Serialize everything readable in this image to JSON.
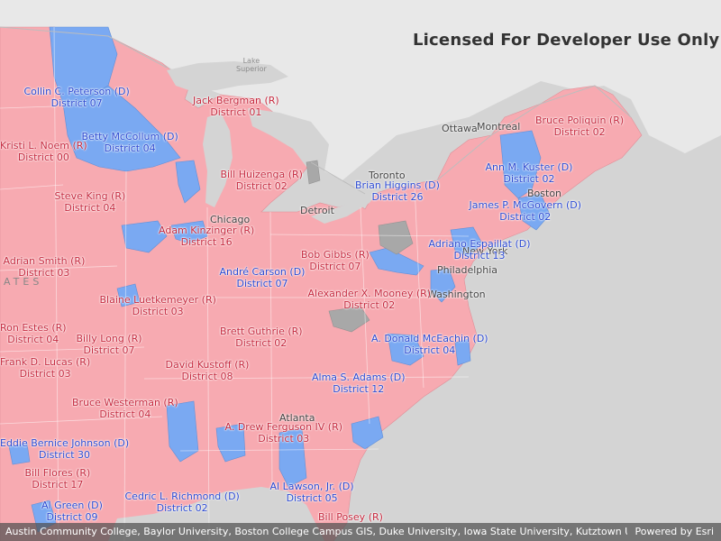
{
  "watermark": "Licensed For Developer Use Only",
  "cities": {
    "ottawa": "Ottawa",
    "montreal": "Montreal",
    "toronto": "Toronto",
    "chicago": "Chicago",
    "detroit": "Detroit",
    "philadelphia": "Philadelphia",
    "new_york": "New York",
    "washington": "Washington",
    "boston": "Boston",
    "atlanta": "Atlanta"
  },
  "lake_superior": [
    "Lake",
    "Superior"
  ],
  "country_fragment": "ATES",
  "colors": {
    "republican_fill": "#f7aab1",
    "democrat_fill": "#7aa9f2",
    "no_data_fill": "#a8a8a8",
    "land": "#e8e8e8",
    "water": "#d4d4d4",
    "republican_text": "#c5283d",
    "democrat_text": "#2b49d1"
  },
  "district_labels": [
    {
      "name": "Collin C. Peterson (D)",
      "district": "District 07",
      "party": "D"
    },
    {
      "name": "Jack Bergman (R)",
      "district": "District 01",
      "party": "R"
    },
    {
      "name": "Betty McCollum (D)",
      "district": "District 04",
      "party": "D"
    },
    {
      "name": "Kristi L. Noem (R)",
      "district": "District 00",
      "party": "R"
    },
    {
      "name": "Bill Huizenga (R)",
      "district": "District 02",
      "party": "R"
    },
    {
      "name": "Bruce Poliquin (R)",
      "district": "District 02",
      "party": "R"
    },
    {
      "name": "Ann M. Kuster (D)",
      "district": "District 02",
      "party": "D"
    },
    {
      "name": "Brian Higgins (D)",
      "district": "District 26",
      "party": "D"
    },
    {
      "name": "James P. McGovern (D)",
      "district": "District 02",
      "party": "D"
    },
    {
      "name": "Steve King (R)",
      "district": "District 04",
      "party": "R"
    },
    {
      "name": "Adam Kinzinger (R)",
      "district": "District 16",
      "party": "R"
    },
    {
      "name": "Adriano Espaillat (D)",
      "district": "District 13",
      "party": "D"
    },
    {
      "name": "Adrian Smith (R)",
      "district": "District 03",
      "party": "R"
    },
    {
      "name": "Bob Gibbs (R)",
      "district": "District 07",
      "party": "R"
    },
    {
      "name": "André Carson (D)",
      "district": "District 07",
      "party": "D"
    },
    {
      "name": "Blaine Luetkemeyer (R)",
      "district": "District 03",
      "party": "R"
    },
    {
      "name": "Alexander X. Mooney (R)",
      "district": "District 02",
      "party": "R"
    },
    {
      "name": "Ron Estes (R)",
      "district": "District 04",
      "party": "R"
    },
    {
      "name": "Brett Guthrie (R)",
      "district": "District 02",
      "party": "R"
    },
    {
      "name": "Billy Long (R)",
      "district": "District 07",
      "party": "R"
    },
    {
      "name": "A. Donald McEachin (D)",
      "district": "District 04",
      "party": "D"
    },
    {
      "name": "Frank D. Lucas (R)",
      "district": "District 03",
      "party": "R"
    },
    {
      "name": "David Kustoff (R)",
      "district": "District 08",
      "party": "R"
    },
    {
      "name": "Alma S. Adams (D)",
      "district": "District 12",
      "party": "D"
    },
    {
      "name": "Bruce Westerman (R)",
      "district": "District 04",
      "party": "R"
    },
    {
      "name": "A. Drew Ferguson IV (R)",
      "district": "District 03",
      "party": "R"
    },
    {
      "name": "Eddie Bernice Johnson (D)",
      "district": "District 30",
      "party": "D"
    },
    {
      "name": "Bill Flores (R)",
      "district": "District 17",
      "party": "R"
    },
    {
      "name": "Al Lawson, Jr. (D)",
      "district": "District 05",
      "party": "D"
    },
    {
      "name": "Cedric L. Richmond (D)",
      "district": "District 02",
      "party": "D"
    },
    {
      "name": "Al Green (D)",
      "district": "District 09",
      "party": "D"
    },
    {
      "name": "Bill Posey (R)",
      "district": "",
      "party": "R"
    }
  ],
  "attribution": {
    "sources": "Austin Community College, Baylor University, Boston College Campus GIS, Duke University, Iowa State University, Kutztown Univer...",
    "powered_by": "Powered by Esri"
  }
}
